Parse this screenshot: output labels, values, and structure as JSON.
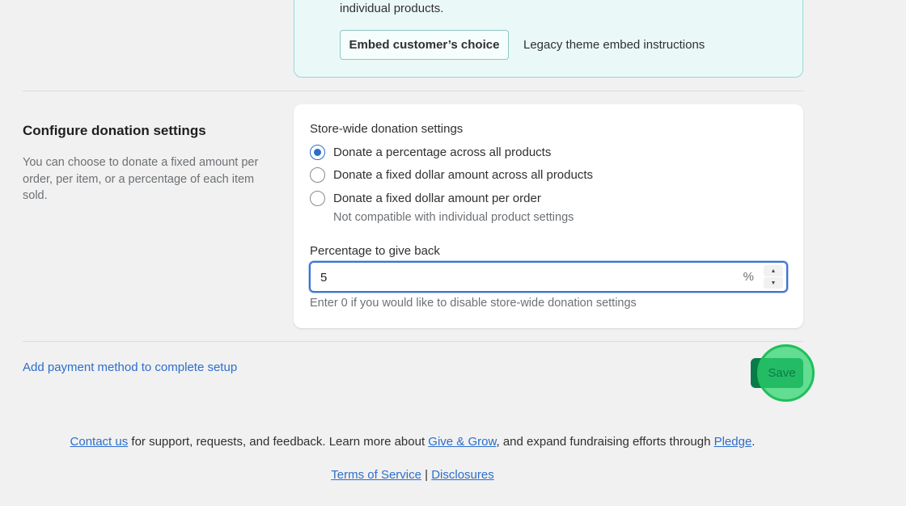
{
  "top_card": {
    "tail_text": "individual products.",
    "embed_button": "Embed customer’s choice",
    "legacy_link": "Legacy theme embed instructions"
  },
  "section": {
    "title": "Configure donation settings",
    "description": "You can choose to donate a fixed amount per order, per item, or a percentage of each item sold."
  },
  "settings": {
    "heading": "Store-wide donation settings",
    "options": [
      {
        "label": "Donate a percentage across all products",
        "checked": true
      },
      {
        "label": "Donate a fixed dollar amount across all products",
        "checked": false
      },
      {
        "label": "Donate a fixed dollar amount per order",
        "checked": false
      }
    ],
    "option_help": "Not compatible with individual product settings",
    "field_label": "Percentage to give back",
    "field_value": "5",
    "field_suffix": "%",
    "field_help": "Enter 0 if you would like to disable store-wide donation settings"
  },
  "footer": {
    "payment_link": "Add payment method to complete setup",
    "save_label": "Save",
    "contact_link": "Contact us",
    "text_1": " for support, requests, and feedback. Learn more about ",
    "give_grow_link": "Give & Grow",
    "text_2": ", and expand fundraising efforts through ",
    "pledge_link": "Pledge",
    "text_3": ".",
    "terms_link": "Terms of Service",
    "separator": " | ",
    "disclosures_link": "Disclosures"
  },
  "colors": {
    "accent_blue": "#2c6ecb",
    "save_green": "#0b7a4b",
    "info_card_bg": "#eaf9f8",
    "click_indicator": "#2cd66e"
  }
}
